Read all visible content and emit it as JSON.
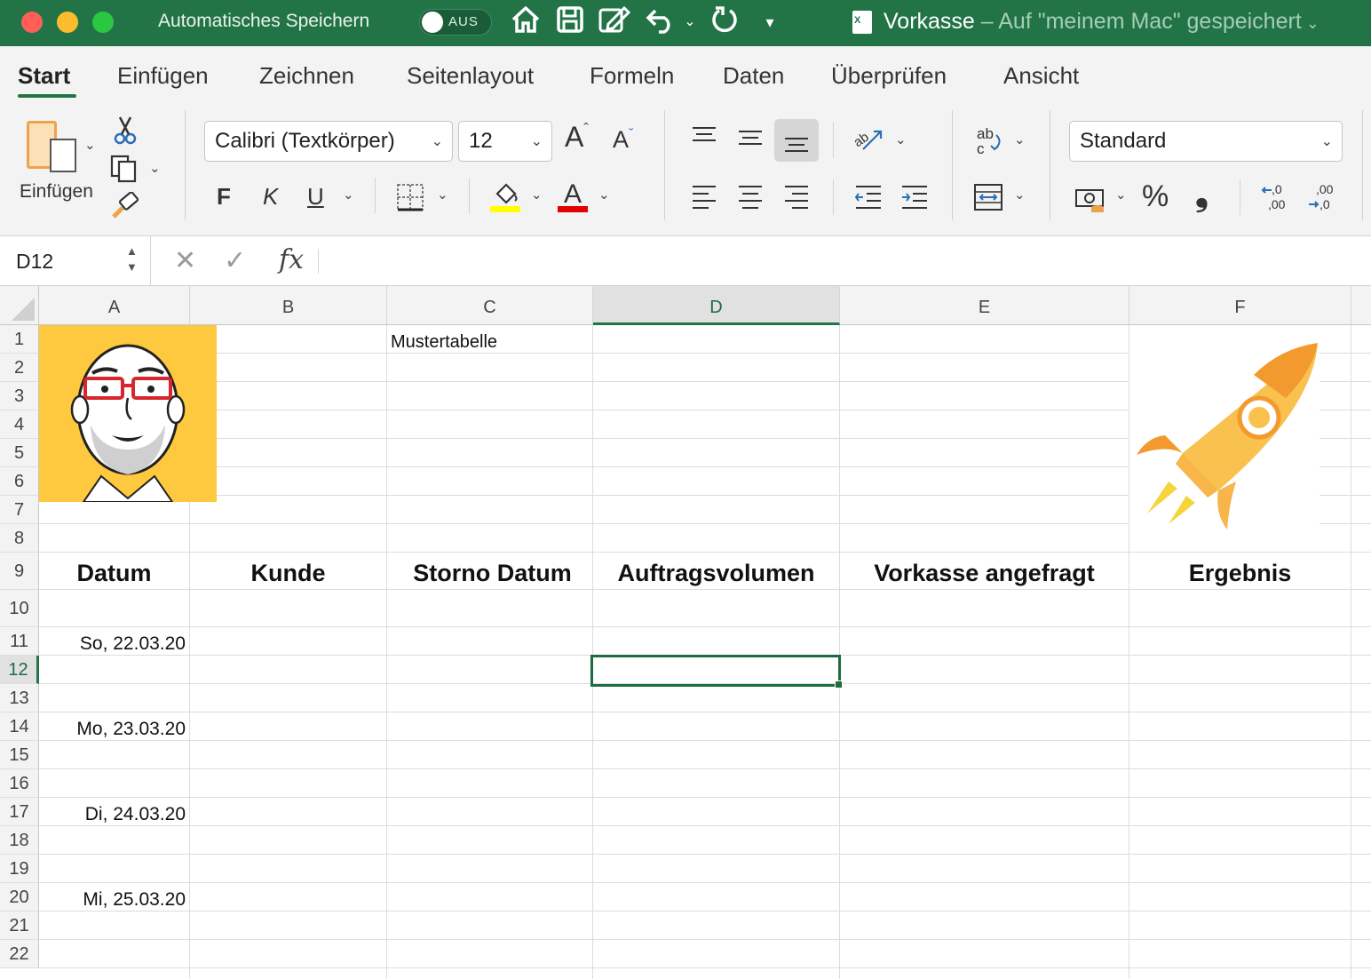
{
  "titlebar": {
    "autosave_label": "Automatisches Speichern",
    "autosave_state": "AUS",
    "doc_name": "Vorkasse",
    "doc_location": " – Auf \"meinem Mac\" gespeichert",
    "accent": "#227447"
  },
  "tabs": [
    "Start",
    "Einfügen",
    "Zeichnen",
    "Seitenlayout",
    "Formeln",
    "Daten",
    "Überprüfen",
    "Ansicht"
  ],
  "active_tab": "Start",
  "ribbon": {
    "paste_label": "Einfügen",
    "font_name": "Calibri (Textkörper)",
    "font_size": "12",
    "bold_label": "F",
    "italic_label": "K",
    "underline_label": "U",
    "number_format": "Standard",
    "percent_label": "%",
    "comma_label": "❟",
    "fill_color": "#ffff00",
    "font_color": "#e00000"
  },
  "formula_bar": {
    "name_box": "D12",
    "fx_label": "fx",
    "formula": ""
  },
  "sheet": {
    "columns": [
      "A",
      "B",
      "C",
      "D",
      "E",
      "F"
    ],
    "selected_column": "D",
    "rows": [
      "1",
      "2",
      "3",
      "4",
      "5",
      "6",
      "7",
      "8",
      "9",
      "10",
      "11",
      "12",
      "13",
      "14",
      "15",
      "16",
      "17",
      "18",
      "19",
      "20",
      "21",
      "22"
    ],
    "selected_row": "12",
    "c1": "Mustertabelle",
    "headers": [
      "Datum",
      "Kunde",
      "Storno Datum",
      "Auftragsvolumen",
      "Vorkasse angefragt",
      "Ergebnis"
    ],
    "dates": [
      {
        "row": "11",
        "value": "So, 22.03.20"
      },
      {
        "row": "14",
        "value": "Mo, 23.03.20"
      },
      {
        "row": "17",
        "value": "Di, 24.03.20"
      },
      {
        "row": "20",
        "value": "Mi, 25.03.20"
      }
    ],
    "active_cell": "D12"
  }
}
